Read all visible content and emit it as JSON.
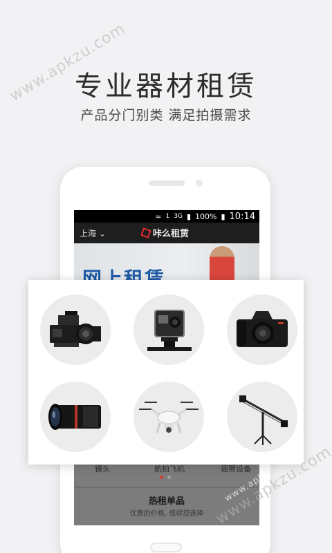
{
  "headline": "专业器材租赁",
  "subline": "产品分门别类 满足拍摄需求",
  "watermark": "www.apkzu.com",
  "status_bar": {
    "sim": "1",
    "network": "3G",
    "battery": "100%",
    "time": "10:14"
  },
  "app_bar": {
    "city": "上海",
    "app_name": "咔么租赁"
  },
  "banner": {
    "text": "网上租赁"
  },
  "categories": [
    {
      "icon": "cinema-camera-icon",
      "label": ""
    },
    {
      "icon": "action-camera-icon",
      "label": ""
    },
    {
      "icon": "dslr-camera-icon",
      "label": ""
    },
    {
      "icon": "lens-icon",
      "label": "镜头"
    },
    {
      "icon": "drone-icon",
      "label": "航拍飞机"
    },
    {
      "icon": "camera-crane-icon",
      "label": "摇臂设备"
    }
  ],
  "pager": {
    "count": 2,
    "active": 1
  },
  "hot_section": {
    "title": "热租单品",
    "subtitle": "优惠的价格, 值得您选择"
  },
  "colors": {
    "background": "#f2f2f4",
    "accent_red": "#d23a2a",
    "banner_blue": "#1e5aa8"
  }
}
